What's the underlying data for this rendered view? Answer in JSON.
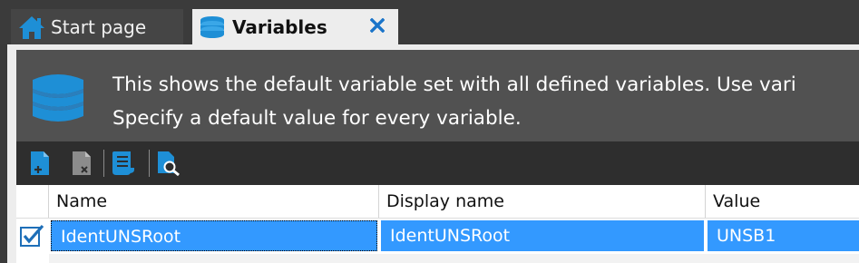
{
  "tabs": [
    {
      "label": "Start page",
      "icon": "home-icon",
      "active": false
    },
    {
      "label": "Variables",
      "icon": "database-icon",
      "active": true,
      "close_icon": "close-icon"
    }
  ],
  "info": {
    "icon": "database-icon",
    "line1": "This shows the default variable set with all defined variables. Use vari",
    "line2": "Specify a default value for every variable."
  },
  "toolbar": {
    "buttons": [
      {
        "name": "add-variable-button",
        "icon": "add-document-icon"
      },
      {
        "name": "delete-variable-button",
        "icon": "delete-document-icon"
      },
      {
        "name": "variable-list-button",
        "icon": "scroll-list-icon"
      },
      {
        "name": "find-usage-button",
        "icon": "search-document-icon"
      }
    ]
  },
  "grid": {
    "columns": [
      "Name",
      "Display name",
      "Value"
    ],
    "rows": [
      {
        "name": "IdentUNSRoot",
        "display_name": "IdentUNSRoot",
        "value": "UNSB1",
        "selected": true
      }
    ]
  },
  "colors": {
    "accent": "#1e8fd6",
    "selection": "#3399ff",
    "close": "#1a74c9"
  }
}
